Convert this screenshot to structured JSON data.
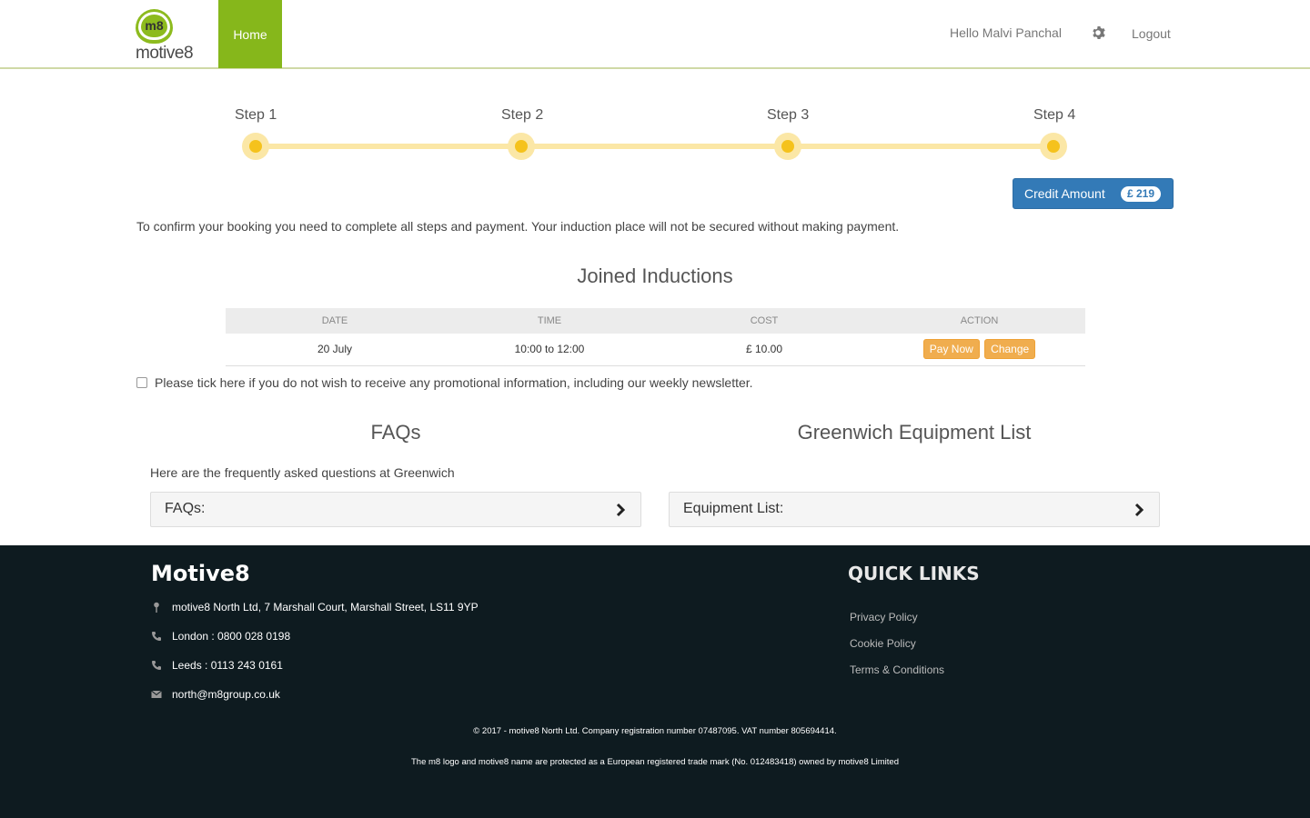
{
  "header": {
    "logo_badge": "m8",
    "logo_word": "motive8",
    "nav_home": "Home",
    "greeting": "Hello Malvi Panchal",
    "settings_icon": "gear-icon",
    "logout": "Logout"
  },
  "steps": [
    "Step 1",
    "Step 2",
    "Step 3",
    "Step 4"
  ],
  "credit": {
    "label": "Credit Amount",
    "amount": "£ 219"
  },
  "confirm_text": "To confirm your booking you need to complete all steps and payment. Your induction place will not be secured without making payment.",
  "inductions": {
    "title": "Joined Inductions",
    "columns": [
      "DATE",
      "TIME",
      "COST",
      "ACTION"
    ],
    "rows": [
      {
        "date": "20 July",
        "time": "10:00 to 12:00",
        "cost": "£ 10.00",
        "pay_label": "Pay Now",
        "change_label": "Change"
      }
    ]
  },
  "newsletter_label": "Please tick here if you do not wish to receive any promotional information, including our weekly newsletter.",
  "faqs": {
    "title": "FAQs",
    "intro": "Here are the frequently asked questions at Greenwich",
    "accordion_label": "FAQs:"
  },
  "equipment": {
    "title": "Greenwich Equipment List",
    "accordion_label": "Equipment List:"
  },
  "footer": {
    "brand": "Motive8",
    "address": "motive8 North Ltd, 7 Marshall Court, Marshall Street, LS11 9YP",
    "london": "London : 0800 028 0198",
    "leeds": "Leeds : 0113 243 0161",
    "email": "north@m8group.co.uk",
    "quick_links_title": "QUICK LINKS",
    "links": [
      "Privacy Policy",
      "Cookie Policy",
      "Terms & Conditions"
    ],
    "copyright": "© 2017 - motive8 North Ltd. Company registration number 07487095. VAT number 805694414.",
    "trademark": "The m8 logo and motive8 name are protected as a European registered trade mark (No. 012483418) owned by motive8 Limited"
  },
  "colors": {
    "brand_green": "#86b71b",
    "primary_blue": "#337ab7",
    "warning_orange": "#f0ad4e",
    "step_yellow": "#f5c21c",
    "footer_bg": "#0e1b20"
  }
}
